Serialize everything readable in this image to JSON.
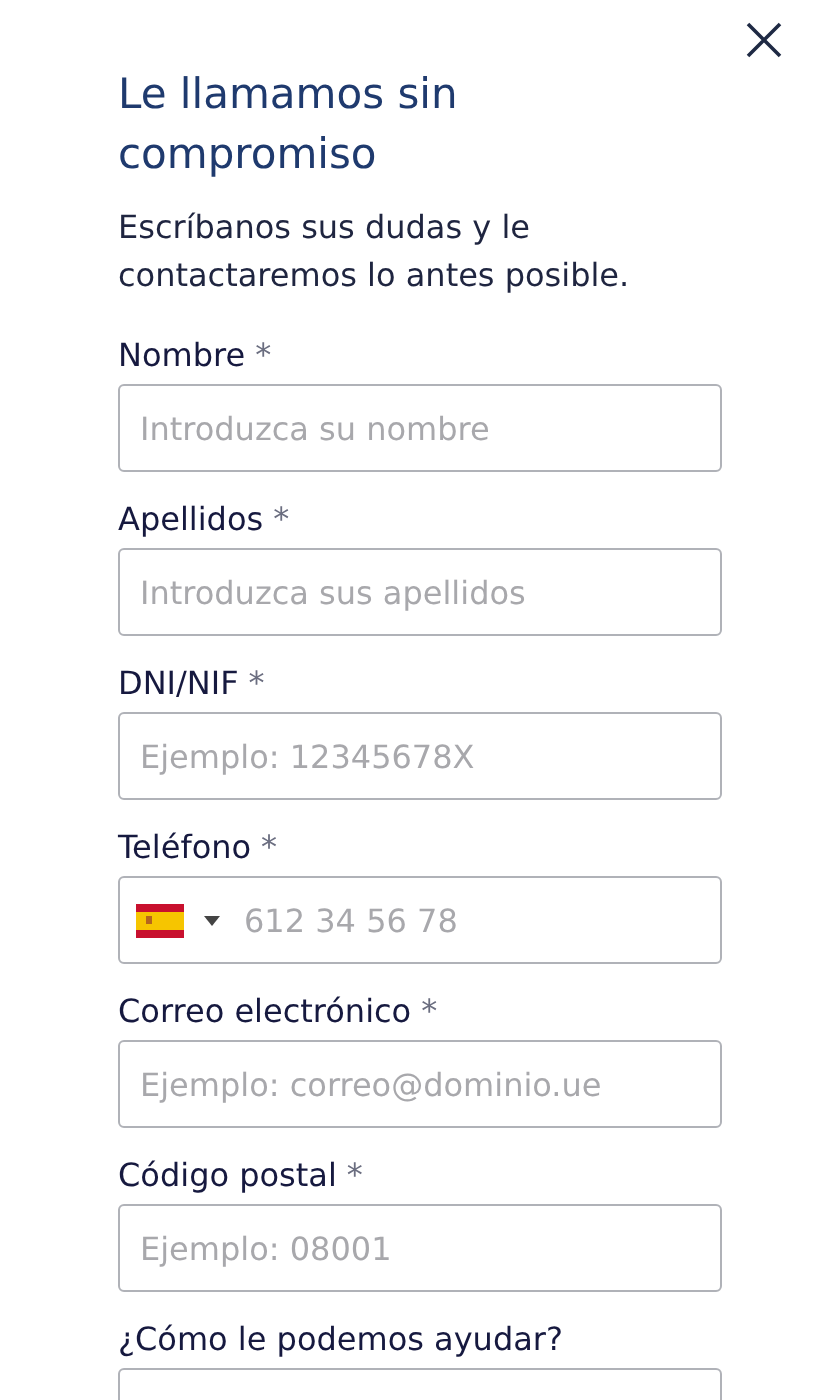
{
  "title": "Le llamamos sin compromiso",
  "subtitle": "Escríbanos sus dudas y le contactaremos lo antes posible.",
  "fields": [
    {
      "kind": "text",
      "label": "Nombre",
      "mark": "*",
      "placeholder": "Introduzca su nombre"
    },
    {
      "kind": "text",
      "label": "Apellidos",
      "mark": "*",
      "placeholder": "Introduzca sus apellidos"
    },
    {
      "kind": "text",
      "label": "DNI/NIF",
      "mark": "*",
      "placeholder": "Ejemplo: 12345678X"
    },
    {
      "kind": "phone",
      "label": "Teléfono",
      "mark": "*",
      "placeholder": "612 34 56 78"
    },
    {
      "kind": "text",
      "label": "Correo electrónico",
      "mark": "*",
      "placeholder": "Ejemplo: correo@dominio.ue"
    },
    {
      "kind": "text",
      "label": "Código postal",
      "mark": "*",
      "placeholder": "Ejemplo: 08001"
    },
    {
      "kind": "textarea",
      "label": "¿Cómo le podemos ayudar?"
    }
  ]
}
